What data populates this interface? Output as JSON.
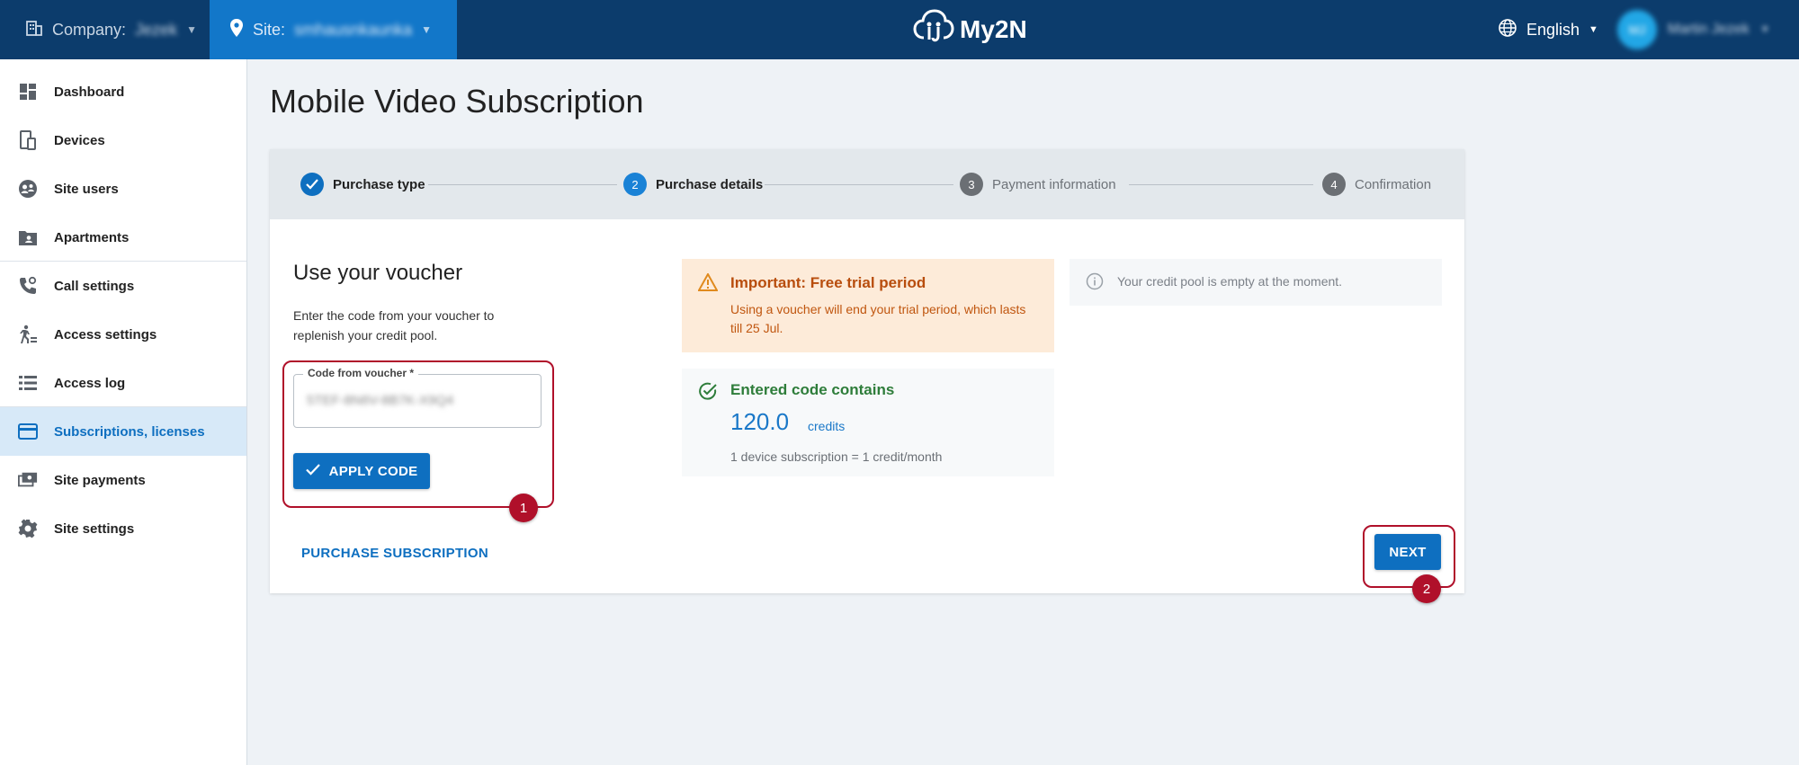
{
  "topbar": {
    "company_label": "Company:",
    "company_value": "Jezek",
    "site_label": "Site:",
    "site_value": "smhausnkaunka",
    "logo_text": "My2N",
    "language": "English",
    "user_initials": "MJ",
    "user_name": "Martin Jezek"
  },
  "sidebar": {
    "items": [
      {
        "label": "Dashboard",
        "icon": "dashboard-icon"
      },
      {
        "label": "Devices",
        "icon": "devices-icon"
      },
      {
        "label": "Site users",
        "icon": "users-icon"
      },
      {
        "label": "Apartments",
        "icon": "apartments-icon"
      },
      {
        "label": "Call settings",
        "icon": "call-settings-icon"
      },
      {
        "label": "Access settings",
        "icon": "access-settings-icon"
      },
      {
        "label": "Access log",
        "icon": "access-log-icon"
      },
      {
        "label": "Subscriptions, licenses",
        "icon": "credit-card-icon",
        "active": true
      },
      {
        "label": "Site payments",
        "icon": "payments-icon"
      },
      {
        "label": "Site settings",
        "icon": "gear-icon"
      }
    ]
  },
  "page": {
    "title": "Mobile Video Subscription"
  },
  "stepper": {
    "steps": [
      {
        "number": "1",
        "label": "Purchase type",
        "state": "done"
      },
      {
        "number": "2",
        "label": "Purchase details",
        "state": "current"
      },
      {
        "number": "3",
        "label": "Payment information",
        "state": "todo"
      },
      {
        "number": "4",
        "label": "Confirmation",
        "state": "todo"
      }
    ]
  },
  "voucher": {
    "title": "Use your voucher",
    "description": "Enter the code from your voucher to replenish your credit pool.",
    "field_label": "Code from voucher *",
    "field_value": "5TEF-8N6V-8B7K-X9Q4",
    "apply_label": "APPLY CODE",
    "purchase_link": "PURCHASE SUBSCRIPTION"
  },
  "alert": {
    "title": "Important: Free trial period",
    "text": "Using a voucher will end your trial period, which lasts till 25 Jul."
  },
  "code_result": {
    "title": "Entered code contains",
    "amount": "120.0",
    "unit": "credits",
    "note": "1 device subscription = 1 credit/month"
  },
  "info": {
    "text": "Your credit pool is empty at the moment."
  },
  "actions": {
    "next_label": "NEXT"
  },
  "annotations": {
    "badge_1": "1",
    "badge_2": "2"
  },
  "colors": {
    "topbar": "#0c3c6c",
    "accent": "#0e6fc0",
    "highlight": "#b0102a",
    "warning_bg": "#fdebd9",
    "success": "#2e7d3a"
  }
}
